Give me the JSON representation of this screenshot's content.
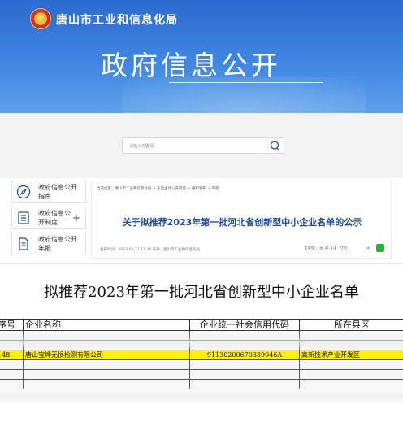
{
  "header": {
    "site_name": "唐山市工业和信息化局",
    "banner_title": "政府信息公开"
  },
  "search": {
    "placeholder": "请输入关键词"
  },
  "left_nav": {
    "items": [
      {
        "label": "政府信息公开指南",
        "icon": "compass-icon"
      },
      {
        "label": "政府信息公开制度",
        "icon": "list-icon"
      },
      {
        "label": "政府信息公开年报",
        "icon": "document-icon"
      }
    ]
  },
  "article": {
    "breadcrumb": "当前位置：唐山市工业和信息化局 > 法定主动公开内容 > 通知发布 > 内容",
    "title": "关于拟推荐2023年第一批河北省创新型中小企业名单的公示",
    "meta": "发布时间：2023-02-21 17:34    来源：唐山市工业和信息化局",
    "tools": "【字体：大 中 小】   打印"
  },
  "document": {
    "title": "拟推荐2023年第一批河北省创新型中小企业名单",
    "columns": [
      "序号",
      "企业名称",
      "企业统一社会信用代码",
      "所在县区"
    ],
    "rows": [
      {
        "no": "",
        "name": "",
        "code": "",
        "district": "",
        "state": "dim"
      },
      {
        "no": "",
        "name": "",
        "code": "",
        "district": "",
        "state": "dim"
      },
      {
        "no": "148",
        "name": "唐山宝烨无损检测有限公司",
        "code": "91130200670339046A",
        "district": "高新技术产业开发区",
        "state": "highlight"
      },
      {
        "no": "",
        "name": "",
        "code": "",
        "district": "",
        "state": "dim"
      },
      {
        "no": "",
        "name": "",
        "code": "",
        "district": "",
        "state": "dim"
      },
      {
        "no": "",
        "name": "",
        "code": "",
        "district": "",
        "state": "dim"
      }
    ]
  },
  "colors": {
    "banner": "#3f86e2",
    "title_blue": "#1d49a8",
    "highlight": "#fff100"
  }
}
